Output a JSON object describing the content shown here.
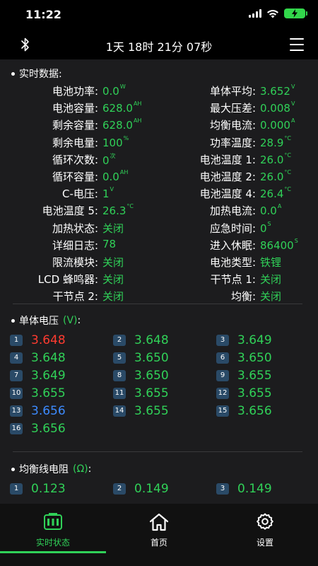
{
  "status": {
    "time": "11:22"
  },
  "header": {
    "title": "1天 18时 21分 07秒"
  },
  "colors": {
    "accent": "#30d158",
    "high": "#ff3b30",
    "low": "#3d8bff",
    "badge": "#2a4a67"
  },
  "realtime": {
    "title": "实时数据:",
    "rows": [
      {
        "l_label": "电池功率:",
        "l_value": "0.0",
        "l_unit": "W",
        "r_label": "单体平均:",
        "r_value": "3.652",
        "r_unit": "V"
      },
      {
        "l_label": "电池容量:",
        "l_value": "628.0",
        "l_unit": "AH",
        "r_label": "最大压差:",
        "r_value": "0.008",
        "r_unit": "V"
      },
      {
        "l_label": "剩余容量:",
        "l_value": "628.0",
        "l_unit": "AH",
        "r_label": "均衡电流:",
        "r_value": "0.000",
        "r_unit": "A"
      },
      {
        "l_label": "剩余电量:",
        "l_value": "100",
        "l_unit": "%",
        "r_label": "功率温度:",
        "r_value": "28.9",
        "r_unit": "°C"
      },
      {
        "l_label": "循环次数:",
        "l_value": "0",
        "l_unit": "次",
        "r_label": "电池温度 1:",
        "r_value": "26.0",
        "r_unit": "°C"
      },
      {
        "l_label": "循环容量:",
        "l_value": "0.0",
        "l_unit": "AH",
        "r_label": "电池温度 2:",
        "r_value": "26.0",
        "r_unit": "°C"
      },
      {
        "l_label": "C-电压:",
        "l_value": "1",
        "l_unit": "V",
        "r_label": "电池温度 4:",
        "r_value": "26.4",
        "r_unit": "°C"
      },
      {
        "l_label": "电池温度 5:",
        "l_value": "26.3",
        "l_unit": "°C",
        "r_label": "加热电流:",
        "r_value": "0.0",
        "r_unit": "A"
      },
      {
        "l_label": "加热状态:",
        "l_value": "关闭",
        "l_unit": "",
        "r_label": "应急时间:",
        "r_value": "0",
        "r_unit": "S"
      },
      {
        "l_label": "详细日志:",
        "l_value": "78",
        "l_unit": "",
        "r_label": "进入休眠:",
        "r_value": "86400",
        "r_unit": "S"
      },
      {
        "l_label": "限流模块:",
        "l_value": "关闭",
        "l_unit": "",
        "r_label": "电池类型:",
        "r_value": "铁锂",
        "r_unit": ""
      },
      {
        "l_label": "LCD 蜂鸣器:",
        "l_value": "关闭",
        "l_unit": "",
        "r_label": "干节点 1:",
        "r_value": "关闭",
        "r_unit": ""
      },
      {
        "l_label": "干节点 2:",
        "l_value": "关闭",
        "l_unit": "",
        "r_label": "均衡:",
        "r_value": "关闭",
        "r_unit": ""
      }
    ]
  },
  "cell_voltage": {
    "title": "单体电压",
    "unit": "(V)",
    "suffix": ":",
    "cells": [
      {
        "n": "1",
        "v": "3.648",
        "state": "high"
      },
      {
        "n": "2",
        "v": "3.648",
        "state": "normal"
      },
      {
        "n": "3",
        "v": "3.649",
        "state": "normal"
      },
      {
        "n": "4",
        "v": "3.648",
        "state": "normal"
      },
      {
        "n": "5",
        "v": "3.650",
        "state": "normal"
      },
      {
        "n": "6",
        "v": "3.650",
        "state": "normal"
      },
      {
        "n": "7",
        "v": "3.649",
        "state": "normal"
      },
      {
        "n": "8",
        "v": "3.650",
        "state": "normal"
      },
      {
        "n": "9",
        "v": "3.655",
        "state": "normal"
      },
      {
        "n": "10",
        "v": "3.655",
        "state": "normal"
      },
      {
        "n": "11",
        "v": "3.655",
        "state": "normal"
      },
      {
        "n": "12",
        "v": "3.655",
        "state": "normal"
      },
      {
        "n": "13",
        "v": "3.656",
        "state": "low"
      },
      {
        "n": "14",
        "v": "3.655",
        "state": "normal"
      },
      {
        "n": "15",
        "v": "3.656",
        "state": "normal"
      },
      {
        "n": "16",
        "v": "3.656",
        "state": "normal"
      }
    ]
  },
  "balance_resistance": {
    "title": "均衡线电阻",
    "unit": "(Ω)",
    "suffix": ":",
    "cells": [
      {
        "n": "1",
        "v": "0.123"
      },
      {
        "n": "2",
        "v": "0.149"
      },
      {
        "n": "3",
        "v": "0.149"
      }
    ]
  },
  "tabs": [
    {
      "label": "实时状态",
      "icon": "battery-status-icon",
      "active": true
    },
    {
      "label": "首页",
      "icon": "home-icon",
      "active": false
    },
    {
      "label": "设置",
      "icon": "gear-icon",
      "active": false
    }
  ]
}
